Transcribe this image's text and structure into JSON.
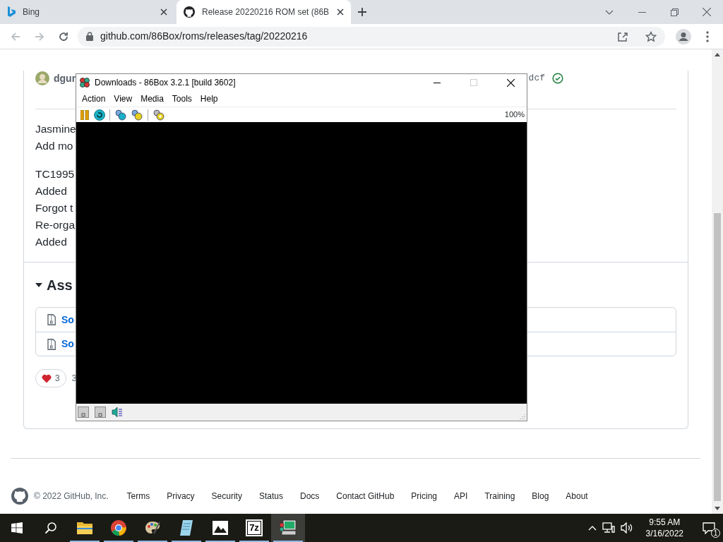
{
  "browser": {
    "tabs": [
      {
        "title": "Bing",
        "selected": false
      },
      {
        "title": "Release 20220216 ROM set (86B",
        "selected": true
      }
    ],
    "url": "github.com/86Box/roms/releases/tag/20220216"
  },
  "release": {
    "author": "dgur",
    "commit": "dcf",
    "notes": [
      [
        "Jasmine",
        "Add mo"
      ],
      [
        "TC1995",
        "Added",
        "Forgot t",
        "Re-orga",
        "Added"
      ]
    ],
    "assets_heading": "Ass",
    "assets_expanded": true,
    "assets": [
      "So",
      "So"
    ],
    "reaction_count": "3",
    "reactors": "3"
  },
  "footer": {
    "copyright": "© 2022 GitHub, Inc.",
    "links": [
      "Terms",
      "Privacy",
      "Security",
      "Status",
      "Docs",
      "Contact GitHub",
      "Pricing",
      "API",
      "Training",
      "Blog",
      "About"
    ]
  },
  "emulator": {
    "title": "Downloads - 86Box 3.2.1 [build 3602]",
    "menu": [
      "Action",
      "View",
      "Media",
      "Tools",
      "Help"
    ],
    "zoom": "100%"
  },
  "taskbar": {
    "apps": [
      {
        "kind": "folder",
        "selected": false
      },
      {
        "kind": "chrome",
        "selected": false
      },
      {
        "kind": "paint",
        "selected": false
      },
      {
        "kind": "notepad",
        "selected": false
      },
      {
        "kind": "photos",
        "selected": false
      },
      {
        "kind": "archiver",
        "label": "7z",
        "selected": false
      },
      {
        "kind": "computer",
        "selected": true
      }
    ],
    "time": "9:55 AM",
    "date": "3/16/2022",
    "notifications": "1"
  }
}
